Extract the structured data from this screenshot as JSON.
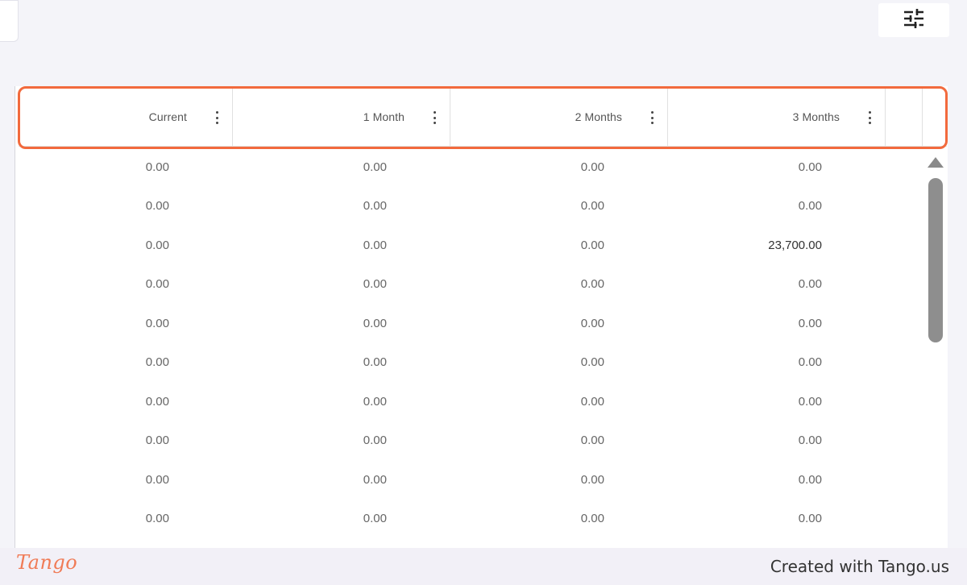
{
  "toolbar": {
    "filter_icon": "tune-sliders-icon"
  },
  "table": {
    "columns": [
      {
        "label": "Current",
        "menu_icon": "kebab-menu-icon"
      },
      {
        "label": "1 Month",
        "menu_icon": "kebab-menu-icon"
      },
      {
        "label": "2 Months",
        "menu_icon": "kebab-menu-icon"
      },
      {
        "label": "3 Months",
        "menu_icon": "kebab-menu-icon"
      }
    ],
    "rows": [
      [
        "0.00",
        "0.00",
        "0.00",
        "0.00"
      ],
      [
        "0.00",
        "0.00",
        "0.00",
        "0.00"
      ],
      [
        "0.00",
        "0.00",
        "0.00",
        "23,700.00"
      ],
      [
        "0.00",
        "0.00",
        "0.00",
        "0.00"
      ],
      [
        "0.00",
        "0.00",
        "0.00",
        "0.00"
      ],
      [
        "0.00",
        "0.00",
        "0.00",
        "0.00"
      ],
      [
        "0.00",
        "0.00",
        "0.00",
        "0.00"
      ],
      [
        "0.00",
        "0.00",
        "0.00",
        "0.00"
      ],
      [
        "0.00",
        "0.00",
        "0.00",
        "0.00"
      ],
      [
        "0.00",
        "0.00",
        "0.00",
        "0.00"
      ]
    ]
  },
  "colors": {
    "highlight": "#f26a3d",
    "brand": "#f07b56"
  },
  "footer": {
    "logo": "Tango",
    "credit": "Created with Tango.us"
  }
}
